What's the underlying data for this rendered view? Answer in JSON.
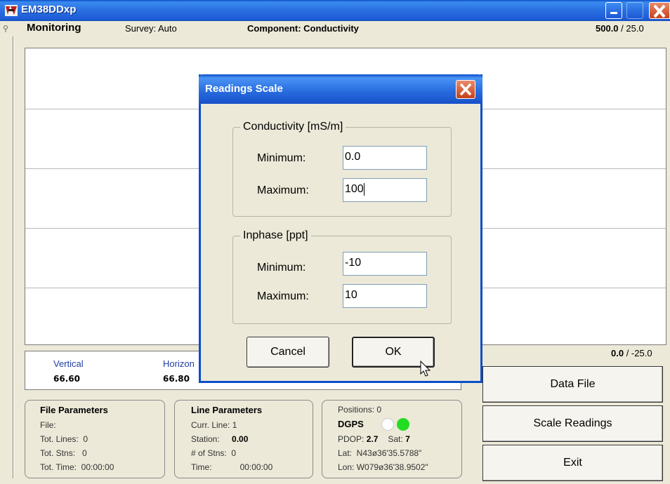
{
  "window": {
    "title": "EM38DDxp"
  },
  "header": {
    "panel": "Monitoring",
    "survey": "Survey: Auto",
    "component": "Component: Conductivity",
    "scale_top_bold": "500.0",
    "scale_top_rest": " / 25.0"
  },
  "scale_bottom": {
    "bold": "0.0",
    "rest": " / -25.0"
  },
  "readings": {
    "vertical_label": "Vertical",
    "vertical_value": "66.60",
    "horizontal_label": "Horizon",
    "horizontal_value": "66.80"
  },
  "file_params": {
    "title": "File Parameters",
    "file": "File:",
    "lines": "Tot. Lines:  0",
    "stns": "Tot. Stns:   0",
    "time": "Tot. Time:  00:00:00"
  },
  "line_params": {
    "title": "Line Parameters",
    "curr": "Curr. Line: 1",
    "station_label": "Station:",
    "station_value": "0.00",
    "nstns": "# of Stns:  0",
    "time_label": "Time:",
    "time_value": "00:00:00"
  },
  "gps": {
    "positions": "Positions: 0",
    "dgps": "DGPS",
    "pdop_label": "PDOP:",
    "pdop_value": "2.7",
    "sat_label": "Sat:",
    "sat_value": "7",
    "lat": "Lat:  N43ø36'35.5788\"",
    "lon": "Lon: W079ø36'38.9502\""
  },
  "buttons": {
    "data_file": "Data File",
    "scale_readings": "Scale Readings",
    "exit": "Exit"
  },
  "dialog": {
    "title": "Readings Scale",
    "conductivity_legend": "Conductivity [mS/m]",
    "inphase_legend": "Inphase [ppt]",
    "minimum_label": "Minimum:",
    "maximum_label": "Maximum:",
    "cond_min": "0.0",
    "cond_max": "100",
    "inph_min": "-10",
    "inph_max": "10",
    "cancel": "Cancel",
    "ok": "OK"
  },
  "colors": {
    "titlebar": "#1d5cd6",
    "dgps_indicator_1": "#ffffff",
    "dgps_indicator_2": "#22dd22"
  }
}
